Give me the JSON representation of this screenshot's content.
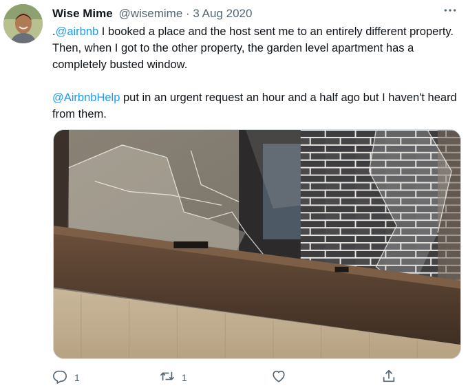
{
  "tweet": {
    "display_name": "Wise Mime",
    "handle": "@wisemime",
    "separator": "·",
    "date": "3 Aug 2020",
    "more_icon": "ellipsis-icon",
    "paragraph1": {
      "lead": ".",
      "mention": "@airbnb",
      "rest": " I booked a place and the host sent me to an entirely different property. Then, when I got to the other property, the garden level apartment has a completely busted window."
    },
    "paragraph2": {
      "mention": "@AirbnbHelp",
      "rest": " put in an urgent request an hour and a half ago but I haven't heard from them."
    }
  },
  "actions": {
    "reply": {
      "icon": "reply-icon",
      "count": "1"
    },
    "retweet": {
      "icon": "retweet-icon",
      "count": "1"
    },
    "like": {
      "icon": "heart-icon"
    },
    "share": {
      "icon": "share-icon"
    }
  },
  "colors": {
    "link": "#1d9bf0",
    "text": "#0f1419",
    "secondary": "#536471"
  }
}
